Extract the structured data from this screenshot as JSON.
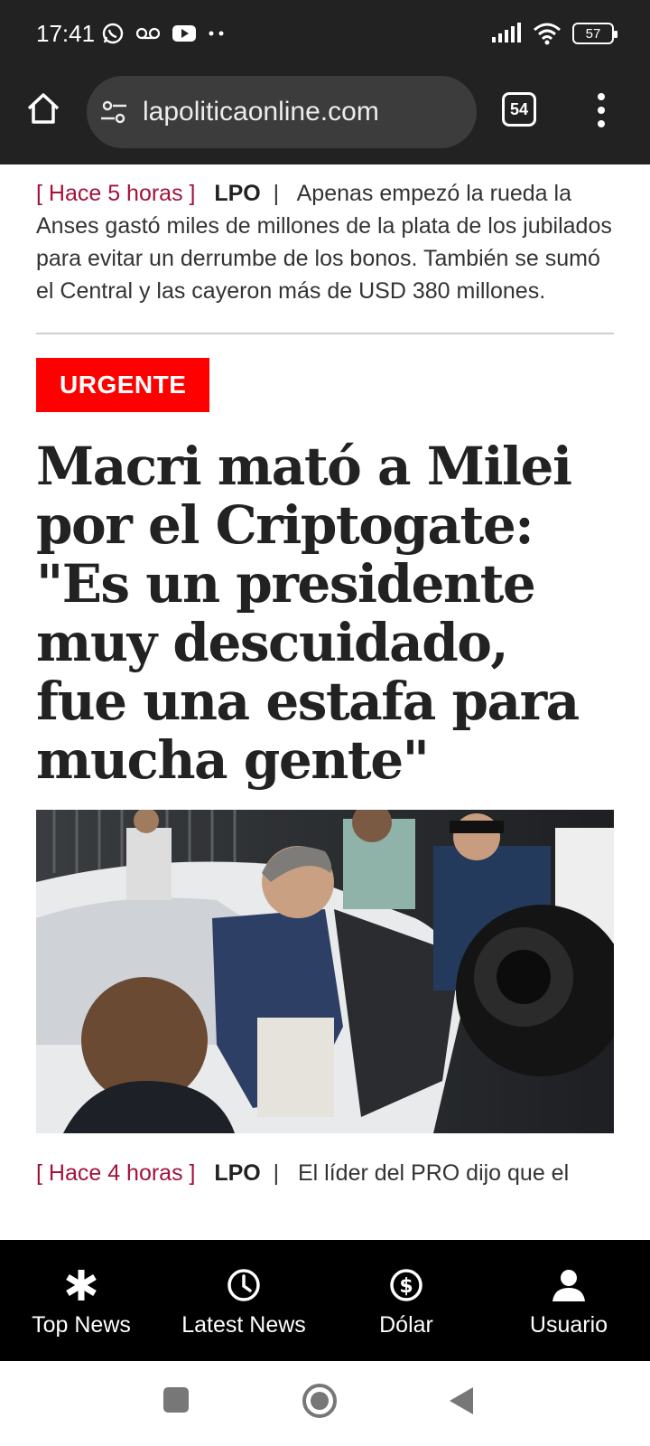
{
  "status_bar": {
    "time": "17:41",
    "battery": "57",
    "icons": [
      "whatsapp-icon",
      "voicemail-icon",
      "youtube-icon",
      "more-dots-icon",
      "signal-icon",
      "wifi-icon",
      "battery-icon"
    ]
  },
  "browser": {
    "url": "lapoliticaonline.com",
    "tab_count": "54"
  },
  "article_prev": {
    "time": "[ Hace 5 horas ]",
    "source": "LPO",
    "separator": "|",
    "summary": "Apenas empezó la rueda la Anses gastó miles de millones de la plata de los jubilados para evitar un derrumbe de los bonos. También se sumó el Central y las cayeron más de USD 380 millones."
  },
  "article_main": {
    "badge": "URGENTE",
    "headline": "Macri mató a Milei por el Criptogate: \"Es un presidente muy descuidado, fue una estafa para mucha gente\"",
    "time": "[ Hace 4 horas ]",
    "source": "LPO",
    "separator": "|",
    "summary": "El líder del PRO dijo que el"
  },
  "bottom_nav": {
    "items": [
      {
        "label": "Top News",
        "icon": "asterisk-icon"
      },
      {
        "label": "Latest News",
        "icon": "clock-icon"
      },
      {
        "label": "Dólar",
        "icon": "dollar-icon"
      },
      {
        "label": "Usuario",
        "icon": "user-icon"
      }
    ]
  },
  "colors": {
    "chrome_bg": "#222222",
    "accent_red": "#ff0000",
    "time_red": "#a3123a",
    "nav_bg": "#000000"
  }
}
